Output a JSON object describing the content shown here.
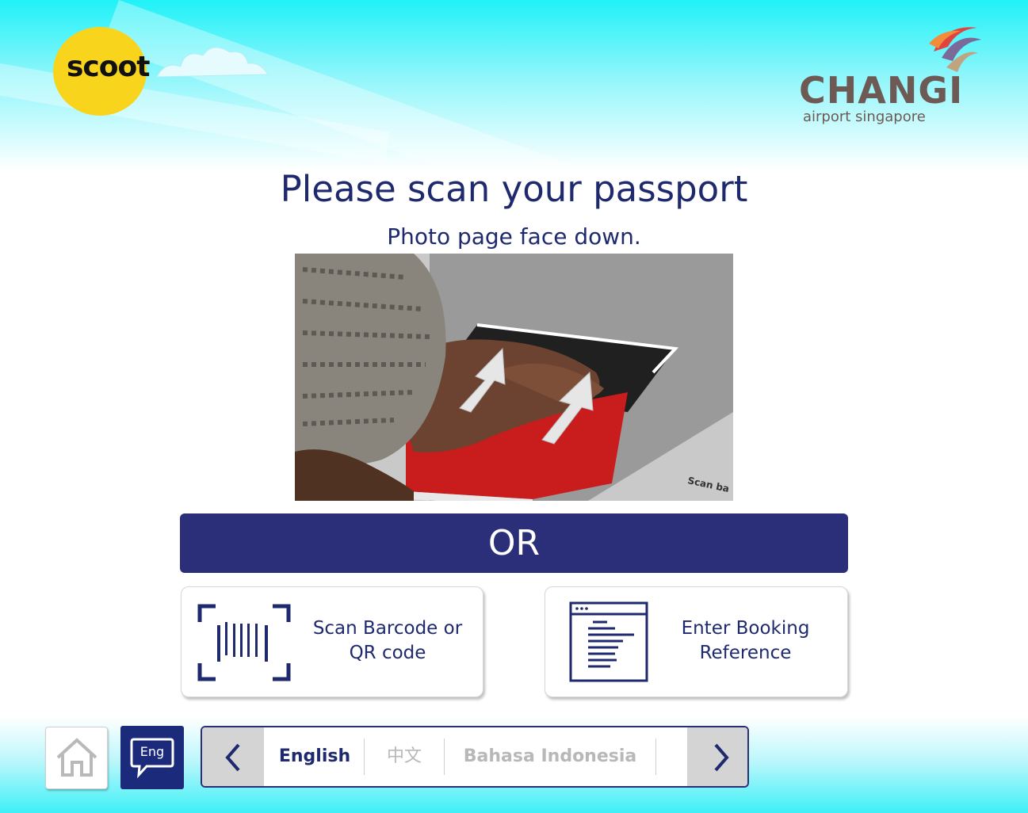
{
  "header": {
    "airline_logo_text": "scoot",
    "airport_logo_text": "CHANGI",
    "airport_logo_subtext": "airport singapore"
  },
  "main": {
    "title": "Please scan your passport",
    "subtitle": "Photo page face down.",
    "photo_caption": "Scan ba",
    "or_label": "OR",
    "options": [
      {
        "label_line1": "Scan Barcode or",
        "label_line2": "QR code",
        "icon": "barcode-icon"
      },
      {
        "label_line1": "Enter Booking",
        "label_line2": "Reference",
        "icon": "document-icon"
      }
    ]
  },
  "footer": {
    "home_icon": "home-icon",
    "lang_button_label": "Eng",
    "languages": [
      "English",
      "中文",
      "Bahasa Indonesia"
    ],
    "selected_language": "English"
  },
  "colors": {
    "navy": "#2b2f7a",
    "scoot_yellow": "#f8d51c",
    "changi_brown": "#6e5a54",
    "sky_cyan": "#1ff2f8"
  }
}
